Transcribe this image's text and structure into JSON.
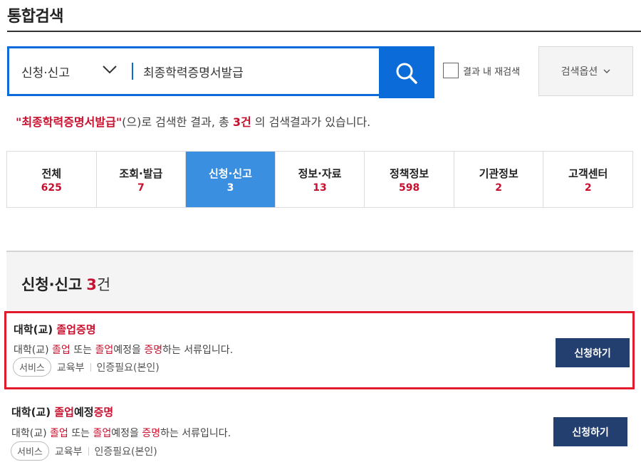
{
  "page": {
    "title": "통합검색"
  },
  "search": {
    "category": "신청·신고",
    "query": "최종학력증명서발급",
    "recheck_label": "결과 내 재검색",
    "options_label": "검색옵션"
  },
  "summary": {
    "keyword": "\"최종학력증명서발급\"",
    "text1": "(으)로 검색한 결과, 총 ",
    "count": "3건",
    "text2": " 의 검색결과가 있습니다."
  },
  "tabs": [
    {
      "label": "전체",
      "count": "625"
    },
    {
      "label": "조회·발급",
      "count": "7"
    },
    {
      "label": "신청·신고",
      "count": "3",
      "active": true
    },
    {
      "label": "정보·자료",
      "count": "13"
    },
    {
      "label": "정책정보",
      "count": "598"
    },
    {
      "label": "기관정보",
      "count": "2"
    },
    {
      "label": "고객센터",
      "count": "2"
    }
  ],
  "section": {
    "title": "신청·신고",
    "count": "3",
    "unit": "건"
  },
  "results": [
    {
      "title_a": "대학(교) ",
      "title_hl": "졸업증명",
      "desc": [
        "대학(교) ",
        "졸업",
        " 또는 ",
        "졸업",
        "예정을 ",
        "증명",
        "하는 서류입니다."
      ],
      "tag": "서비스",
      "org": "교육부",
      "auth": "인증필요(본인)",
      "button": "신청하기"
    },
    {
      "title_a": "대학(교) ",
      "title_hl": "졸업",
      "title_b": "예정",
      "title_hl2": "증명",
      "desc": [
        "대학(교) ",
        "졸업",
        " 또는 ",
        "졸업",
        "예정을 ",
        "증명",
        "하는 서류입니다."
      ],
      "tag": "서비스",
      "org": "교육부",
      "auth": "인증필요(본인)",
      "button": "신청하기"
    }
  ],
  "colors": {
    "primary": "#0a6bd9",
    "accent_red": "#c8102e",
    "active_tab": "#3a8fe0",
    "button_navy": "#233f70",
    "highlight_border": "#e11b2b"
  }
}
